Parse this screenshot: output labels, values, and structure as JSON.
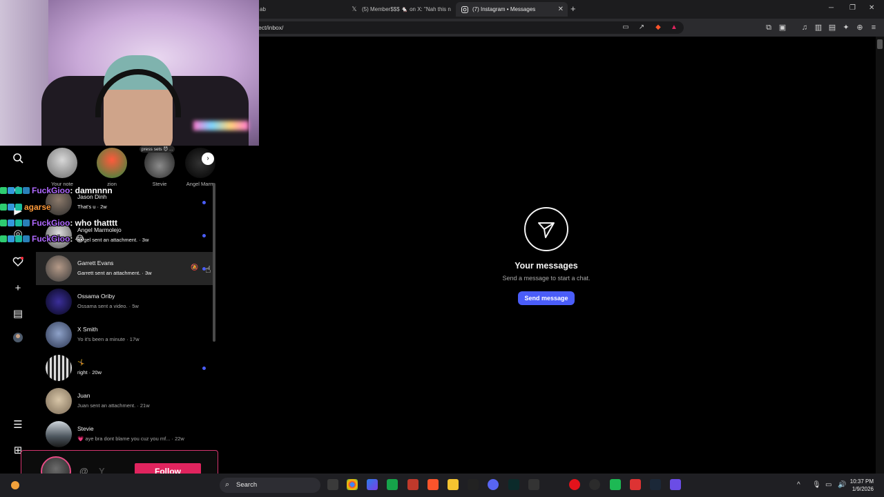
{
  "browser": {
    "tabs": [
      {
        "label": "ab",
        "icon": "blank-icon"
      },
      {
        "label": "(5) Member$$$ 🐁 on X: \"Nah this n",
        "icon": "x-logo-icon"
      },
      {
        "label": "(7) Instagram • Messages",
        "icon": "instagram-icon",
        "active": true
      }
    ],
    "url": "ect/inbox/",
    "close_glyph": "✕",
    "new_tab_glyph": "+"
  },
  "notes": {
    "bubble": "press sets 😈 ...",
    "items": [
      {
        "name": "Your note"
      },
      {
        "name": "zion"
      },
      {
        "name": "Stevie"
      },
      {
        "name": "Angel Marm"
      }
    ]
  },
  "threads": [
    {
      "name": "Jason Dinh",
      "preview": "That's u · 2w",
      "unread": true
    },
    {
      "name": "Angel Marmolejo",
      "preview": "Angel sent an attachment. · 3w",
      "unread": true
    },
    {
      "name": "Garrett Evans",
      "preview": "Garrett sent an attachment. · 3w",
      "unread": true,
      "active": true,
      "muted": true
    },
    {
      "name": "Ossama Oriby",
      "preview": "Ossama sent a video. · 5w"
    },
    {
      "name": "X Smith",
      "preview": "Yo it's been a minute · 17w"
    },
    {
      "name": "🤸",
      "preview": "right · 20w",
      "unread": true
    },
    {
      "name": "Juan",
      "preview": "Juan sent an attachment. · 21w"
    },
    {
      "name": "Stevie",
      "preview": "💗 aye bra dont blame you cuz you mf... · 22w"
    }
  ],
  "empty_state": {
    "title": "Your messages",
    "subtitle": "Send a message to start a chat.",
    "button": "Send message"
  },
  "chat": [
    {
      "user": "FuckGioo",
      "message": " : damnnnn",
      "color": "purple"
    },
    {
      "user": "agarse",
      "message": "",
      "color": "orange"
    },
    {
      "user": "FuckGioo",
      "message": " : who thatttt",
      "color": "purple"
    },
    {
      "user": "FuckGioo",
      "message": " : 😂",
      "color": "purple"
    }
  ],
  "follow_alert": {
    "at": "@",
    "name_initial": "Y",
    "button": "Follow"
  },
  "taskbar": {
    "search_label": "Search",
    "time": "10:37 PM",
    "date": "1/9/2026"
  },
  "colors": {
    "accent": "#4a5df9",
    "follow": "#e0245e",
    "chat_user_purple": "#b069ff",
    "chat_user_orange": "#ff9a3a"
  }
}
